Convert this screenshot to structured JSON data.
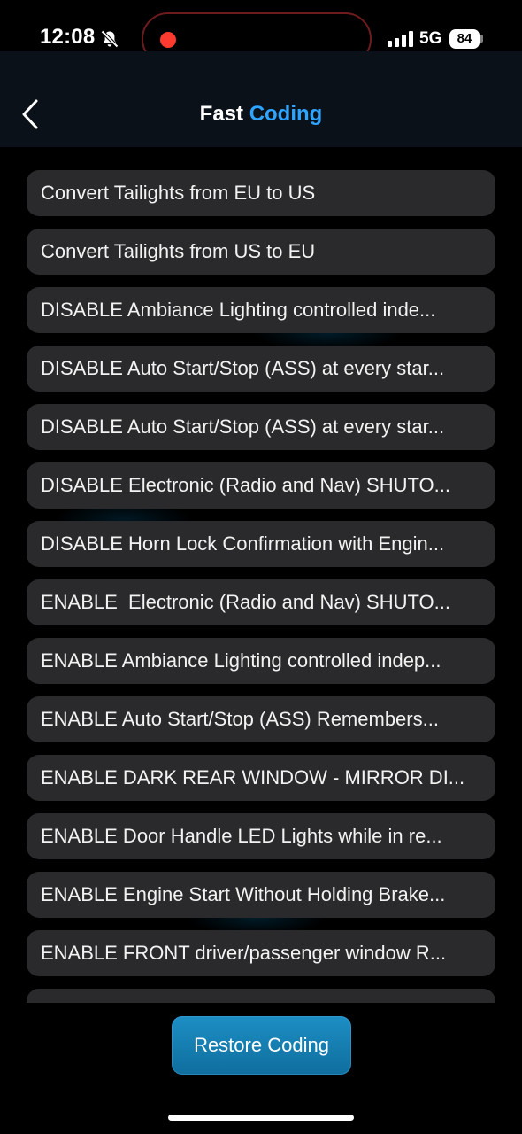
{
  "status_bar": {
    "time": "12:08",
    "network": "5G",
    "battery": "84",
    "icons": [
      "bell-off-icon",
      "signal-icon",
      "battery-icon"
    ]
  },
  "header": {
    "back_icon": "chevron-left-icon",
    "title_part1": "Fast",
    "title_part2": "Coding"
  },
  "coding_list": {
    "items": [
      "Convert Tailights from EU to US",
      "Convert Tailights from US to EU",
      "DISABLE Ambiance Lighting controlled inde...",
      "DISABLE Auto Start/Stop (ASS) at every star...",
      "DISABLE Auto Start/Stop (ASS) at every star...",
      "DISABLE Electronic (Radio and Nav) SHUTO...",
      "DISABLE Horn Lock Confirmation with Engin...",
      "ENABLE  Electronic (Radio and Nav) SHUTO...",
      "ENABLE Ambiance Lighting controlled indep...",
      "ENABLE Auto Start/Stop (ASS) Remembers...",
      "ENABLE DARK REAR WINDOW - MIRROR DI...",
      "ENABLE Door Handle LED Lights while in re...",
      "ENABLE Engine Start Without Holding Brake...",
      "ENABLE FRONT driver/passenger window R..."
    ]
  },
  "footer": {
    "restore_label": "Restore Coding"
  },
  "colors": {
    "accent": "#2ea4ff",
    "item_background": "#2a2a2c",
    "button_background": "#1d8ec4",
    "recording_dot": "#ff3b30"
  }
}
